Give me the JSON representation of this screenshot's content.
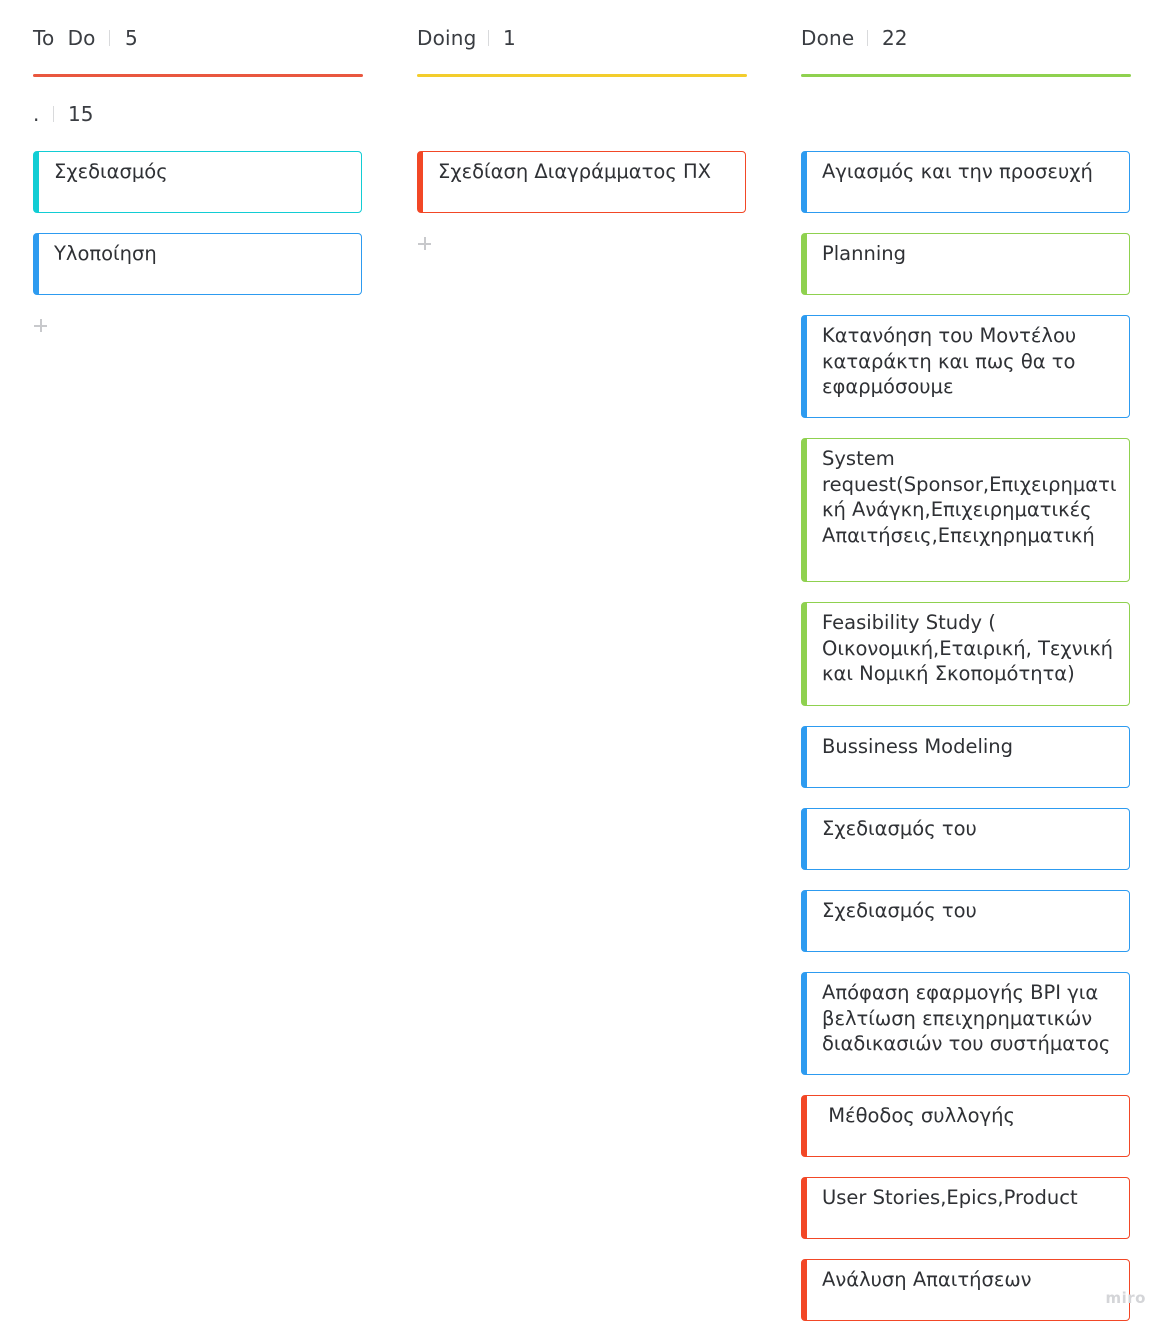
{
  "colors": {
    "todo_accent": "#e9573f",
    "doing_accent": "#f3cd2c",
    "done_accent": "#8fd14f",
    "card_blue": "#2d9bf0",
    "card_cyan": "#12cdd4",
    "card_red": "#f24726",
    "card_green": "#8fd14f",
    "divider": "#d9dadc"
  },
  "columns": [
    {
      "key": "todo",
      "title": "To  Do",
      "count": "5",
      "subgroup": {
        "label": ".",
        "count": "15"
      },
      "cards": [
        {
          "text": "Σχεδιασμός",
          "color": "cyan"
        },
        {
          "text": "Υλοποίηση",
          "color": "blue"
        }
      ]
    },
    {
      "key": "doing",
      "title": "Doing",
      "count": "1",
      "cards": [
        {
          "text": "Σχεδίαση Διαγράμματος ΠΧ",
          "color": "red"
        }
      ]
    },
    {
      "key": "done",
      "title": "Done",
      "count": "22",
      "cards": [
        {
          "text": "Αγιασμός και την προσευχή",
          "color": "blue"
        },
        {
          "text": "Planning",
          "color": "green"
        },
        {
          "text": "Κατανόηση του Μοντέλου καταράκτη και πως θα το εφαρμόσουμε",
          "color": "blue"
        },
        {
          "text": "System request(Sponsor,Επιχειρηματική Ανάγκη,Επιχειρηματικές Απαιτήσεις,Επειχηρηματική",
          "color": "green"
        },
        {
          "text": "Feasibility Study ( Οικονομική,Εταιρική, Τεχνική και Νομική Σκοπομότητα)",
          "color": "green"
        },
        {
          "text": "Bussiness Modeling",
          "color": "blue"
        },
        {
          "text": "Σχεδιασμός του",
          "color": "blue"
        },
        {
          "text": "Σχεδιασμός του",
          "color": "blue"
        },
        {
          "text": "Απόφαση εφαρμογής BPI για βελτίωση επειχηρηματικών διαδικασιών του συστήματος",
          "color": "blue"
        },
        {
          "text": " Μέθοδος συλλογής",
          "color": "red"
        },
        {
          "text": "User Stories,Epics,Product",
          "color": "red"
        },
        {
          "text": "Ανάλυση Απαιτήσεων",
          "color": "red"
        }
      ]
    }
  ],
  "watermark": "miro"
}
